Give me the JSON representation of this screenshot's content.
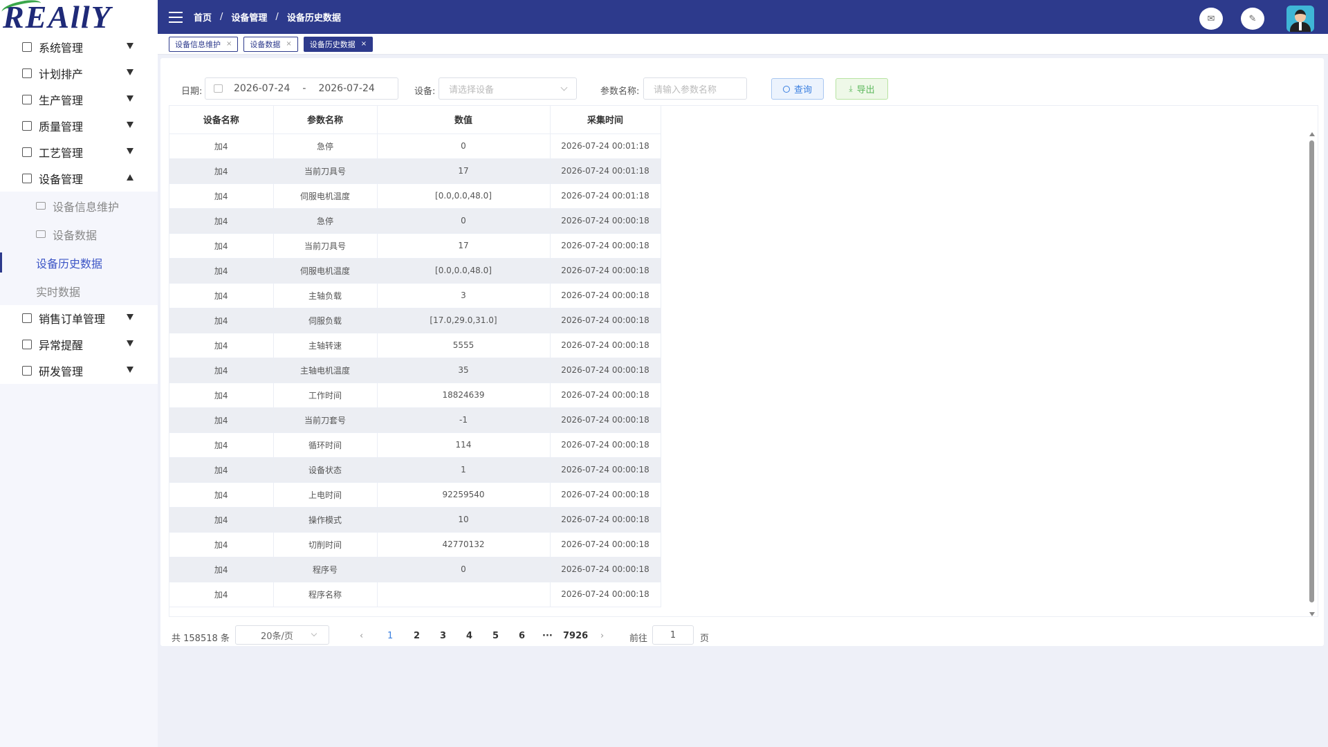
{
  "logo": {
    "text": "REAllY"
  },
  "sidebar": {
    "items": [
      {
        "label": "系统管理",
        "expanded": false
      },
      {
        "label": "计划排产",
        "expanded": false
      },
      {
        "label": "生产管理",
        "expanded": false
      },
      {
        "label": "质量管理",
        "expanded": false
      },
      {
        "label": "工艺管理",
        "expanded": false
      },
      {
        "label": "设备管理",
        "expanded": true
      },
      {
        "label": "销售订单管理",
        "expanded": false
      },
      {
        "label": "异常提醒",
        "expanded": false
      },
      {
        "label": "研发管理",
        "expanded": false
      }
    ],
    "submenu": [
      {
        "label": "设备信息维护"
      },
      {
        "label": "设备数据"
      },
      {
        "label": "设备历史数据",
        "active": true
      },
      {
        "label": "实时数据"
      }
    ]
  },
  "header": {
    "breadcrumb": [
      "首页",
      "设备管理",
      "设备历史数据"
    ],
    "separator": "/",
    "mail_icon": "✉",
    "edit_icon": "✎"
  },
  "tabs": [
    {
      "label": "设备信息维护",
      "active": false
    },
    {
      "label": "设备数据",
      "active": false
    },
    {
      "label": "设备历史数据",
      "active": true
    }
  ],
  "tab_close": "×",
  "filters": {
    "date_label": "日期:",
    "date_start": "2026-07-24",
    "date_sep": "-",
    "date_end": "2026-07-24",
    "device_label": "设备:",
    "device_placeholder": "请选择设备",
    "param_label": "参数名称:",
    "param_placeholder": "请输入参数名称",
    "query_label": "查询",
    "export_label": "导出",
    "export_icon": "⤓"
  },
  "table": {
    "columns": [
      "设备名称",
      "参数名称",
      "数值",
      "采集时间"
    ],
    "rows": [
      [
        "加4",
        "急停",
        "0",
        "2026-07-24 00:01:18"
      ],
      [
        "加4",
        "当前刀具号",
        "17",
        "2026-07-24 00:01:18"
      ],
      [
        "加4",
        "伺服电机温度",
        "[0.0,0.0,48.0]",
        "2026-07-24 00:01:18"
      ],
      [
        "加4",
        "急停",
        "0",
        "2026-07-24 00:00:18"
      ],
      [
        "加4",
        "当前刀具号",
        "17",
        "2026-07-24 00:00:18"
      ],
      [
        "加4",
        "伺服电机温度",
        "[0.0,0.0,48.0]",
        "2026-07-24 00:00:18"
      ],
      [
        "加4",
        "主轴负载",
        "3",
        "2026-07-24 00:00:18"
      ],
      [
        "加4",
        "伺服负载",
        "[17.0,29.0,31.0]",
        "2026-07-24 00:00:18"
      ],
      [
        "加4",
        "主轴转速",
        "5555",
        "2026-07-24 00:00:18"
      ],
      [
        "加4",
        "主轴电机温度",
        "35",
        "2026-07-24 00:00:18"
      ],
      [
        "加4",
        "工作时间",
        "18824639",
        "2026-07-24 00:00:18"
      ],
      [
        "加4",
        "当前刀套号",
        "-1",
        "2026-07-24 00:00:18"
      ],
      [
        "加4",
        "循环时间",
        "114",
        "2026-07-24 00:00:18"
      ],
      [
        "加4",
        "设备状态",
        "1",
        "2026-07-24 00:00:18"
      ],
      [
        "加4",
        "上电时间",
        "92259540",
        "2026-07-24 00:00:18"
      ],
      [
        "加4",
        "操作模式",
        "10",
        "2026-07-24 00:00:18"
      ],
      [
        "加4",
        "切削时间",
        "42770132",
        "2026-07-24 00:00:18"
      ],
      [
        "加4",
        "程序号",
        "0",
        "2026-07-24 00:00:18"
      ],
      [
        "加4",
        "程序名称",
        "",
        "2026-07-24 00:00:18"
      ]
    ]
  },
  "pagination": {
    "total_text": "共 158518 条",
    "page_size": "20条/页",
    "pages": [
      "1",
      "2",
      "3",
      "4",
      "5",
      "6"
    ],
    "ellipsis": "···",
    "last_page": "7926",
    "current": "1",
    "prev": "‹",
    "next": "›",
    "goto_label": "前往",
    "goto_value": "1",
    "page_unit": "页"
  },
  "colors": {
    "header_bg": "#2d3a8c",
    "accent": "#3c55c6",
    "query_blue": "#3a7fe0",
    "export_green": "#5cb85c"
  }
}
